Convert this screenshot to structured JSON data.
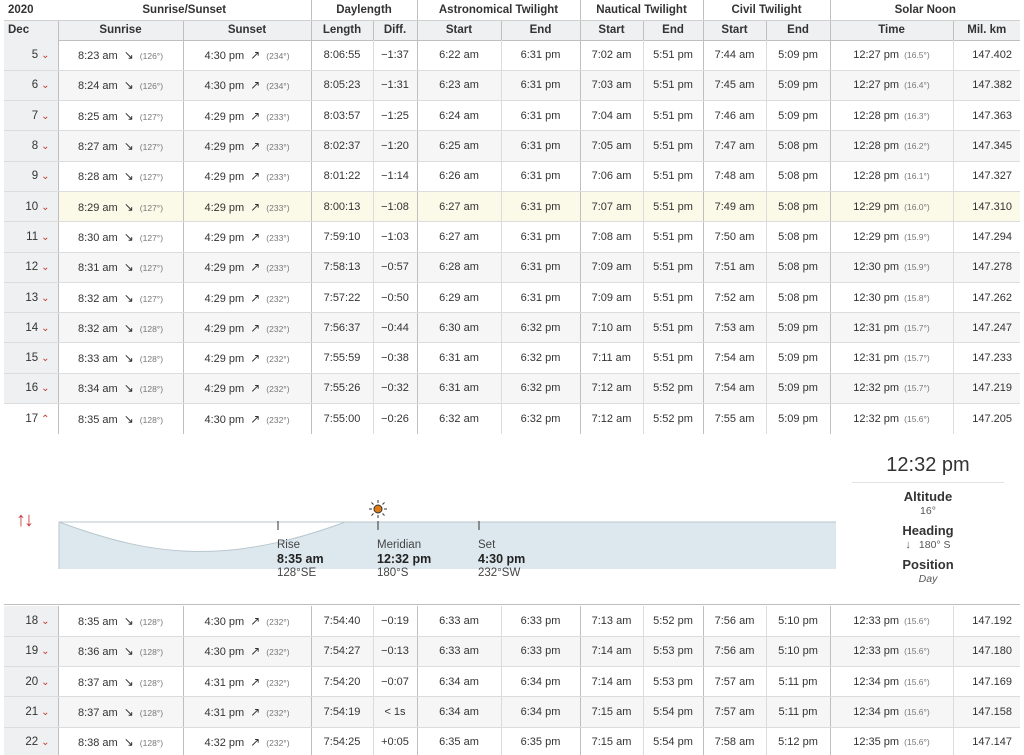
{
  "header": {
    "year": "2020",
    "month": "Dec",
    "groups": {
      "sun": "Sunrise/Sunset",
      "day": "Daylength",
      "astro": "Astronomical Twilight",
      "naut": "Nautical Twilight",
      "civil": "Civil Twilight",
      "noon": "Solar Noon"
    },
    "cols": {
      "sunrise": "Sunrise",
      "sunset": "Sunset",
      "length": "Length",
      "diff": "Diff.",
      "astro_start": "Start",
      "astro_end": "End",
      "naut_start": "Start",
      "naut_end": "End",
      "civil_start": "Start",
      "civil_end": "End",
      "noon_time": "Time",
      "mil_km": "Mil. km"
    }
  },
  "rows": [
    {
      "day": "5",
      "rise": "8:23 am",
      "rise_ang": "(126°)",
      "set": "4:30 pm",
      "set_ang": "(234°)",
      "len": "8:06:55",
      "diff": "−1:37",
      "as": "6:22 am",
      "ae": "6:31 pm",
      "ns": "7:02 am",
      "ne": "5:51 pm",
      "cs": "7:44 am",
      "ce": "5:09 pm",
      "noon": "12:27 pm",
      "noon_alt": "(16.5°)",
      "km": "147.402"
    },
    {
      "day": "6",
      "rise": "8:24 am",
      "rise_ang": "(126°)",
      "set": "4:30 pm",
      "set_ang": "(234°)",
      "len": "8:05:23",
      "diff": "−1:31",
      "as": "6:23 am",
      "ae": "6:31 pm",
      "ns": "7:03 am",
      "ne": "5:51 pm",
      "cs": "7:45 am",
      "ce": "5:09 pm",
      "noon": "12:27 pm",
      "noon_alt": "(16.4°)",
      "km": "147.382"
    },
    {
      "day": "7",
      "rise": "8:25 am",
      "rise_ang": "(127°)",
      "set": "4:29 pm",
      "set_ang": "(233°)",
      "len": "8:03:57",
      "diff": "−1:25",
      "as": "6:24 am",
      "ae": "6:31 pm",
      "ns": "7:04 am",
      "ne": "5:51 pm",
      "cs": "7:46 am",
      "ce": "5:09 pm",
      "noon": "12:28 pm",
      "noon_alt": "(16.3°)",
      "km": "147.363"
    },
    {
      "day": "8",
      "rise": "8:27 am",
      "rise_ang": "(127°)",
      "set": "4:29 pm",
      "set_ang": "(233°)",
      "len": "8:02:37",
      "diff": "−1:20",
      "as": "6:25 am",
      "ae": "6:31 pm",
      "ns": "7:05 am",
      "ne": "5:51 pm",
      "cs": "7:47 am",
      "ce": "5:08 pm",
      "noon": "12:28 pm",
      "noon_alt": "(16.2°)",
      "km": "147.345"
    },
    {
      "day": "9",
      "rise": "8:28 am",
      "rise_ang": "(127°)",
      "set": "4:29 pm",
      "set_ang": "(233°)",
      "len": "8:01:22",
      "diff": "−1:14",
      "as": "6:26 am",
      "ae": "6:31 pm",
      "ns": "7:06 am",
      "ne": "5:51 pm",
      "cs": "7:48 am",
      "ce": "5:08 pm",
      "noon": "12:28 pm",
      "noon_alt": "(16.1°)",
      "km": "147.327"
    },
    {
      "day": "10",
      "rise": "8:29 am",
      "rise_ang": "(127°)",
      "set": "4:29 pm",
      "set_ang": "(233°)",
      "len": "8:00:13",
      "diff": "−1:08",
      "as": "6:27 am",
      "ae": "6:31 pm",
      "ns": "7:07 am",
      "ne": "5:51 pm",
      "cs": "7:49 am",
      "ce": "5:08 pm",
      "noon": "12:29 pm",
      "noon_alt": "(16.0°)",
      "km": "147.310"
    },
    {
      "day": "11",
      "rise": "8:30 am",
      "rise_ang": "(127°)",
      "set": "4:29 pm",
      "set_ang": "(233°)",
      "len": "7:59:10",
      "diff": "−1:03",
      "as": "6:27 am",
      "ae": "6:31 pm",
      "ns": "7:08 am",
      "ne": "5:51 pm",
      "cs": "7:50 am",
      "ce": "5:08 pm",
      "noon": "12:29 pm",
      "noon_alt": "(15.9°)",
      "km": "147.294"
    },
    {
      "day": "12",
      "rise": "8:31 am",
      "rise_ang": "(127°)",
      "set": "4:29 pm",
      "set_ang": "(233°)",
      "len": "7:58:13",
      "diff": "−0:57",
      "as": "6:28 am",
      "ae": "6:31 pm",
      "ns": "7:09 am",
      "ne": "5:51 pm",
      "cs": "7:51 am",
      "ce": "5:08 pm",
      "noon": "12:30 pm",
      "noon_alt": "(15.9°)",
      "km": "147.278"
    },
    {
      "day": "13",
      "rise": "8:32 am",
      "rise_ang": "(127°)",
      "set": "4:29 pm",
      "set_ang": "(232°)",
      "len": "7:57:22",
      "diff": "−0:50",
      "as": "6:29 am",
      "ae": "6:31 pm",
      "ns": "7:09 am",
      "ne": "5:51 pm",
      "cs": "7:52 am",
      "ce": "5:08 pm",
      "noon": "12:30 pm",
      "noon_alt": "(15.8°)",
      "km": "147.262"
    },
    {
      "day": "14",
      "rise": "8:32 am",
      "rise_ang": "(128°)",
      "set": "4:29 pm",
      "set_ang": "(232°)",
      "len": "7:56:37",
      "diff": "−0:44",
      "as": "6:30 am",
      "ae": "6:32 pm",
      "ns": "7:10 am",
      "ne": "5:51 pm",
      "cs": "7:53 am",
      "ce": "5:09 pm",
      "noon": "12:31 pm",
      "noon_alt": "(15.7°)",
      "km": "147.247"
    },
    {
      "day": "15",
      "rise": "8:33 am",
      "rise_ang": "(128°)",
      "set": "4:29 pm",
      "set_ang": "(232°)",
      "len": "7:55:59",
      "diff": "−0:38",
      "as": "6:31 am",
      "ae": "6:32 pm",
      "ns": "7:11 am",
      "ne": "5:51 pm",
      "cs": "7:54 am",
      "ce": "5:09 pm",
      "noon": "12:31 pm",
      "noon_alt": "(15.7°)",
      "km": "147.233"
    },
    {
      "day": "16",
      "rise": "8:34 am",
      "rise_ang": "(128°)",
      "set": "4:29 pm",
      "set_ang": "(232°)",
      "len": "7:55:26",
      "diff": "−0:32",
      "as": "6:31 am",
      "ae": "6:32 pm",
      "ns": "7:12 am",
      "ne": "5:52 pm",
      "cs": "7:54 am",
      "ce": "5:09 pm",
      "noon": "12:32 pm",
      "noon_alt": "(15.7°)",
      "km": "147.219"
    },
    {
      "day": "17",
      "rise": "8:35 am",
      "rise_ang": "(128°)",
      "set": "4:30 pm",
      "set_ang": "(232°)",
      "len": "7:55:00",
      "diff": "−0:26",
      "as": "6:32 am",
      "ae": "6:32 pm",
      "ns": "7:12 am",
      "ne": "5:52 pm",
      "cs": "7:55 am",
      "ce": "5:09 pm",
      "noon": "12:32 pm",
      "noon_alt": "(15.6°)",
      "km": "147.205"
    }
  ],
  "rows_after": [
    {
      "day": "18",
      "rise": "8:35 am",
      "rise_ang": "(128°)",
      "set": "4:30 pm",
      "set_ang": "(232°)",
      "len": "7:54:40",
      "diff": "−0:19",
      "as": "6:33 am",
      "ae": "6:33 pm",
      "ns": "7:13 am",
      "ne": "5:52 pm",
      "cs": "7:56 am",
      "ce": "5:10 pm",
      "noon": "12:33 pm",
      "noon_alt": "(15.6°)",
      "km": "147.192"
    },
    {
      "day": "19",
      "rise": "8:36 am",
      "rise_ang": "(128°)",
      "set": "4:30 pm",
      "set_ang": "(232°)",
      "len": "7:54:27",
      "diff": "−0:13",
      "as": "6:33 am",
      "ae": "6:33 pm",
      "ns": "7:14 am",
      "ne": "5:53 pm",
      "cs": "7:56 am",
      "ce": "5:10 pm",
      "noon": "12:33 pm",
      "noon_alt": "(15.6°)",
      "km": "147.180"
    },
    {
      "day": "20",
      "rise": "8:37 am",
      "rise_ang": "(128°)",
      "set": "4:31 pm",
      "set_ang": "(232°)",
      "len": "7:54:20",
      "diff": "−0:07",
      "as": "6:34 am",
      "ae": "6:34 pm",
      "ns": "7:14 am",
      "ne": "5:53 pm",
      "cs": "7:57 am",
      "ce": "5:11 pm",
      "noon": "12:34 pm",
      "noon_alt": "(15.6°)",
      "km": "147.169"
    },
    {
      "day": "21",
      "rise": "8:37 am",
      "rise_ang": "(128°)",
      "set": "4:31 pm",
      "set_ang": "(232°)",
      "len": "7:54:19",
      "diff": "< 1s",
      "as": "6:34 am",
      "ae": "6:34 pm",
      "ns": "7:15 am",
      "ne": "5:54 pm",
      "cs": "7:57 am",
      "ce": "5:11 pm",
      "noon": "12:34 pm",
      "noon_alt": "(15.6°)",
      "km": "147.158"
    },
    {
      "day": "22",
      "rise": "8:38 am",
      "rise_ang": "(128°)",
      "set": "4:32 pm",
      "set_ang": "(232°)",
      "len": "7:54:25",
      "diff": "+0:05",
      "as": "6:35 am",
      "ae": "6:35 pm",
      "ns": "7:15 am",
      "ne": "5:54 pm",
      "cs": "7:58 am",
      "ce": "5:12 pm",
      "noon": "12:35 pm",
      "noon_alt": "(15.6°)",
      "km": "147.147"
    }
  ],
  "highlight_day": "10",
  "expanded_day": "17",
  "detail": {
    "rise": {
      "title": "Rise",
      "time": "8:35 am",
      "dir": "128°SE"
    },
    "meridian": {
      "title": "Meridian",
      "time": "12:32 pm",
      "dir": "180°S"
    },
    "set": {
      "title": "Set",
      "time": "4:30 pm",
      "dir": "232°SW"
    },
    "current_time": "12:32 pm",
    "altitude_label": "Altitude",
    "altitude_value": "16°",
    "heading_label": "Heading",
    "heading_value": "180° S",
    "position_label": "Position",
    "position_value": "Day"
  },
  "colors": {
    "accent": "#c0392b",
    "sky": "#dde8ee",
    "highlight": "#fbf9e8",
    "sun": "#f0a020"
  }
}
